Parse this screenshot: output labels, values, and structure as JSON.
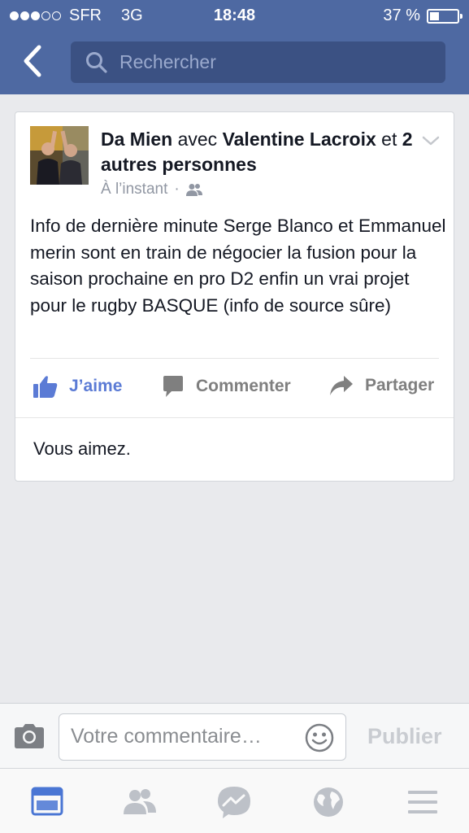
{
  "status_bar": {
    "carrier": "SFR",
    "network": "3G",
    "time": "18:48",
    "battery": "37 %",
    "battery_level": 0.37,
    "signal_bars": 3
  },
  "header": {
    "search_placeholder": "Rechercher",
    "back_icon": "chevron-left-icon",
    "search_icon": "search-icon"
  },
  "post": {
    "author_name": "Da Mien",
    "with_word": "avec",
    "tagged_name": "Valentine Lacroix",
    "and_word": "et",
    "others": "2 autres personnes",
    "timestamp": "À l’instant",
    "privacy_icon": "friends-icon",
    "text": "Info de dernière minute Serge Blanco et Emmanuel merin sont en train de négocier la fusion pour la saison prochaine en pro D2 enfin un vrai projet pour le rugby BASQUE (info de source sûre)",
    "actions": {
      "like_label": "J’aime",
      "comment_label": "Commenter",
      "share_label": "Partager"
    },
    "likes_text": "Vous aimez."
  },
  "comment_bar": {
    "placeholder": "Votre commentaire…",
    "publish_label": "Publier"
  },
  "tabs": [
    "news-feed-icon",
    "friends-icon",
    "messenger-icon",
    "globe-icon",
    "menu-icon"
  ],
  "colors": {
    "header_bg": "#4e69a2",
    "search_bg": "#3b5183",
    "like_blue": "#5b7bd5",
    "background": "#e9eaed"
  }
}
